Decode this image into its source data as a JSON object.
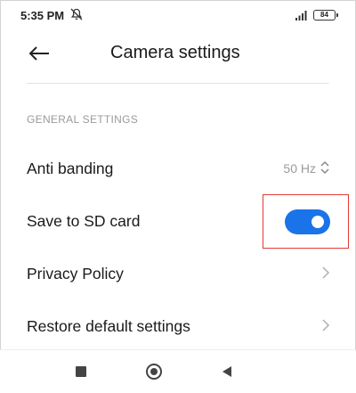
{
  "status_bar": {
    "time": "5:35 PM",
    "dnd_icon": "notifications-off-icon",
    "signal_icon": "signal-bars-icon",
    "battery_level": "84"
  },
  "header": {
    "back_icon": "arrow-left-icon",
    "title": "Camera settings"
  },
  "section_title": "GENERAL SETTINGS",
  "settings": [
    {
      "label": "Anti banding",
      "value": "50 Hz",
      "control": "select",
      "icon": "unfold-icon"
    },
    {
      "label": "Save to SD card",
      "control": "toggle",
      "checked": true
    },
    {
      "label": "Privacy Policy",
      "control": "link",
      "icon": "chevron-right-icon"
    },
    {
      "label": "Restore default settings",
      "control": "link",
      "icon": "chevron-right-icon"
    }
  ],
  "colors": {
    "accent": "#1a73e8",
    "highlight_border": "#e53935",
    "secondary_text": "#9a9a9a"
  },
  "nav_bar": {
    "items": [
      "recent-apps-icon",
      "home-icon",
      "back-icon"
    ]
  }
}
